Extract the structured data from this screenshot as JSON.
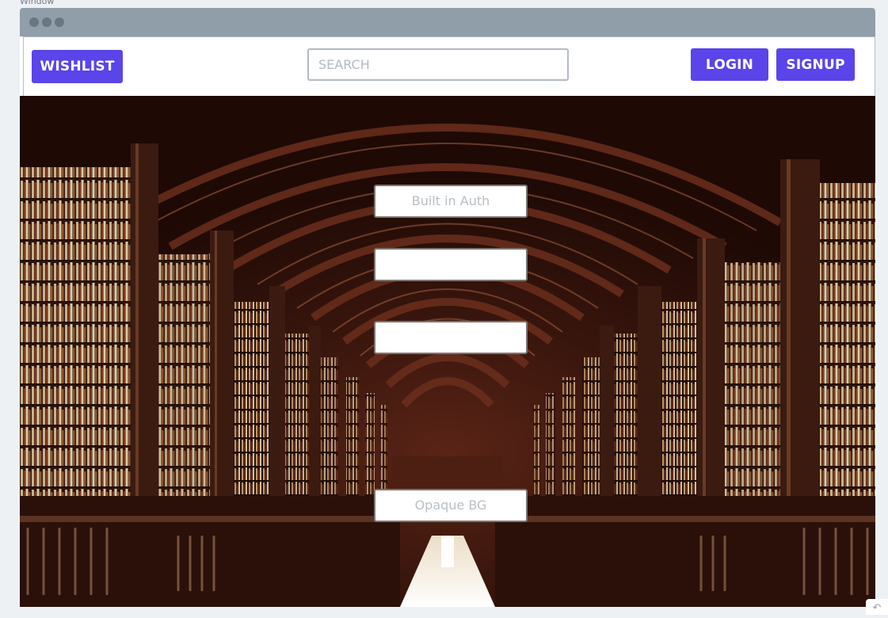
{
  "window": {
    "caption": "Window"
  },
  "navbar": {
    "wishlist_label": "WISHLIST",
    "search_placeholder": "SEARCH",
    "login_label": "LOGIN",
    "signup_label": "SIGNUP"
  },
  "panel": {
    "top_label": "Built in Auth",
    "bottom_label": "Opaque BG"
  },
  "colors": {
    "accent": "#5a44ea",
    "titlebar": "#909ea9"
  },
  "icons": {
    "corner": "undo-icon"
  }
}
